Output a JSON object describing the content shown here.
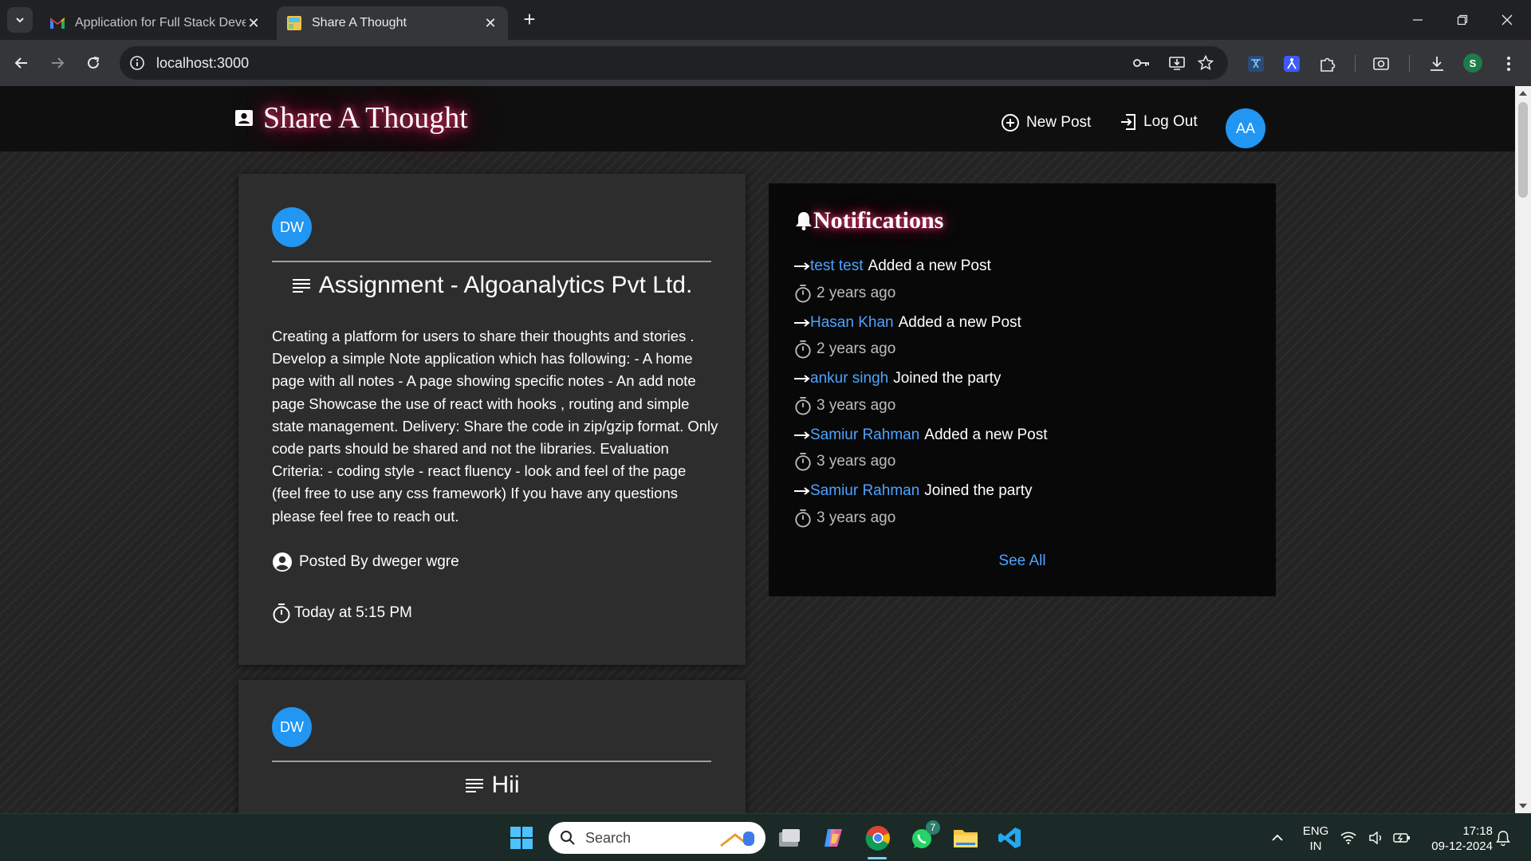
{
  "browser": {
    "tabs": [
      {
        "title": "Application for Full Stack Developer",
        "icon": "gmail-icon",
        "active": false
      },
      {
        "title": "Share A Thought",
        "icon": "site-icon",
        "active": true
      }
    ],
    "url": "localhost:3000"
  },
  "app": {
    "brand": "Share A Thought",
    "nav": {
      "new_post": "New Post",
      "log_out": "Log Out",
      "avatar": "AA"
    },
    "posts": [
      {
        "avatar": "DW",
        "title": "Assignment - Algoanalytics Pvt Ltd.",
        "body": "Creating a platform for users to share their thoughts and stories . Develop a simple Note application which has following: - A home page with all notes - A page showing specific notes - An add note page Showcase the use of react with hooks , routing and simple state management. Delivery: Share the code in zip/gzip format. Only code parts should be shared and not the libraries. Evaluation Criteria: - coding style - react fluency - look and feel of the page (feel free to use any css framework) If you have any questions please feel free to reach out.",
        "posted_by": "Posted By dweger wgre",
        "time": "Today at 5:15 PM"
      },
      {
        "avatar": "DW",
        "title": "Hii"
      }
    ],
    "notifications": {
      "title": "Notifications",
      "items": [
        {
          "user": "test test",
          "action": "Added a new Post",
          "time": "2 years ago"
        },
        {
          "user": "Hasan Khan",
          "action": "Added a new Post",
          "time": "2 years ago"
        },
        {
          "user": "ankur singh",
          "action": "Joined the party",
          "time": "3 years ago"
        },
        {
          "user": "Samiur Rahman",
          "action": "Added a new Post",
          "time": "3 years ago"
        },
        {
          "user": "Samiur Rahman",
          "action": "Joined the party",
          "time": "3 years ago"
        }
      ],
      "see_all": "See All"
    }
  },
  "taskbar": {
    "search_placeholder": "Search",
    "whatsapp_badge": "7",
    "lang_line1": "ENG",
    "lang_line2": "IN",
    "clock_time": "17:18",
    "clock_date": "09-12-2024"
  },
  "colors": {
    "accent_blue": "#2196f3",
    "link_blue": "#4ea3ff",
    "glow_pink": "#ff3b6b",
    "card_bg": "#2d2d2d",
    "notif_bg": "#080808"
  }
}
